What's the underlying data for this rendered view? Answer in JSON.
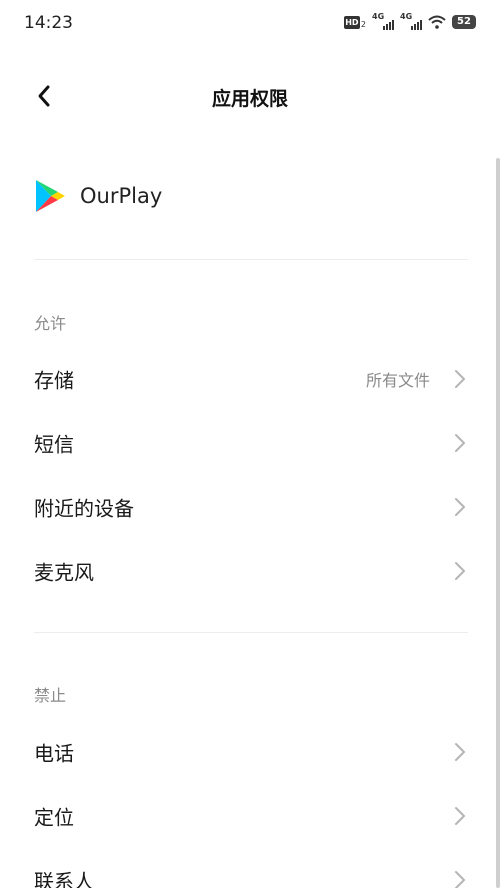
{
  "status_bar": {
    "time": "14:23",
    "hd_label": "HD",
    "hd_sub": "2",
    "net1": "4G",
    "net2": "4G",
    "battery": "52"
  },
  "header": {
    "title": "应用权限",
    "back_icon": "chevron-left-icon"
  },
  "app": {
    "name": "OurPlay",
    "icon": "play-store-triangle-icon",
    "icon_colors": [
      "#00c3ff",
      "#ffd400",
      "#ff3a44",
      "#22d673"
    ]
  },
  "sections": [
    {
      "label": "允许",
      "items": [
        {
          "label": "存储",
          "value": "所有文件"
        },
        {
          "label": "短信",
          "value": ""
        },
        {
          "label": "附近的设备",
          "value": ""
        },
        {
          "label": "麦克风",
          "value": ""
        }
      ]
    },
    {
      "label": "禁止",
      "items": [
        {
          "label": "电话",
          "value": ""
        },
        {
          "label": "定位",
          "value": ""
        },
        {
          "label": "联系人",
          "value": ""
        }
      ]
    }
  ]
}
